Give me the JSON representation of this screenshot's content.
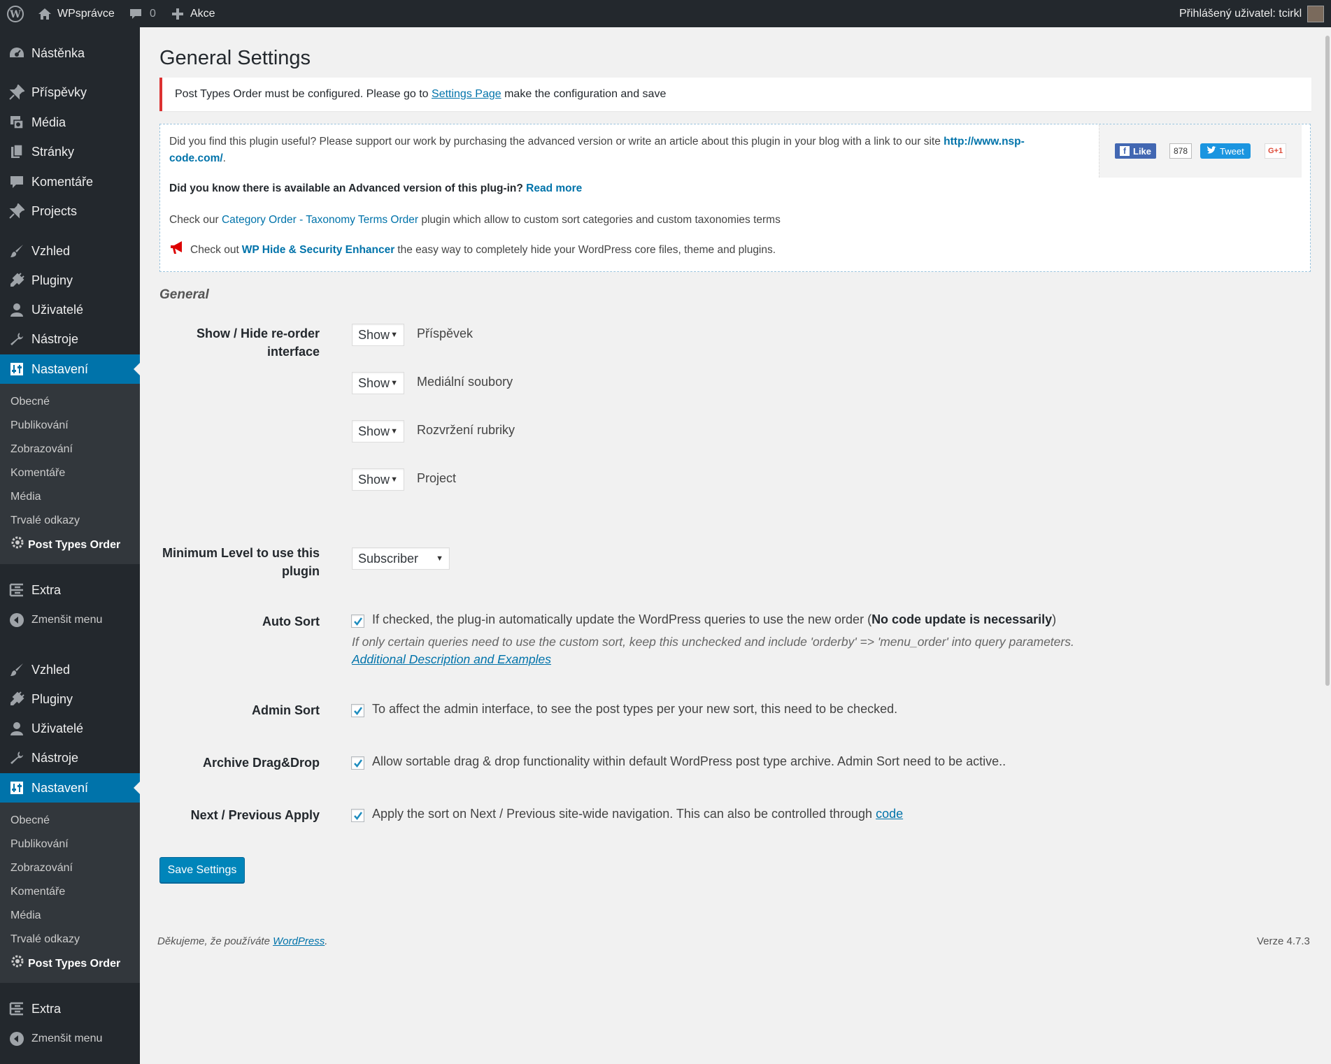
{
  "adminbar": {
    "site_name": "WPsprávce",
    "comments_count": "0",
    "new_label": "Akce",
    "user_greeting": "Přihlášený uživatel: tcirkl"
  },
  "sidebar": {
    "block1": {
      "dashboard": "Nástěnka",
      "posts": "Příspěvky",
      "media": "Média",
      "pages": "Stránky",
      "comments": "Komentáře",
      "projects": "Projects",
      "appearance": "Vzhled",
      "plugins": "Pluginy",
      "users": "Uživatelé",
      "tools": "Nástroje",
      "settings": "Nastavení",
      "sub": [
        "Obecné",
        "Publikování",
        "Zobrazování",
        "Komentáře",
        "Média",
        "Trvalé odkazy"
      ],
      "sub_active": "Post Types Order",
      "extra": "Extra",
      "collapse": "Zmenšit menu"
    },
    "block2": {
      "appearance": "Vzhled",
      "plugins": "Pluginy",
      "users": "Uživatelé",
      "tools": "Nástroje",
      "settings": "Nastavení",
      "sub": [
        "Obecné",
        "Publikování",
        "Zobrazování",
        "Komentáře",
        "Média",
        "Trvalé odkazy"
      ],
      "sub_active": "Post Types Order",
      "extra": "Extra",
      "collapse": "Zmenšit menu"
    }
  },
  "page": {
    "title": "General Settings",
    "notice": {
      "before": "Post Types Order must be configured. Please go to ",
      "link": "Settings Page",
      "after": " make the configuration and save"
    },
    "promo": {
      "p1_text": "Did you find this plugin useful? Please support our work by purchasing the advanced version or write an article about this plugin in your blog with a link to our site ",
      "p1_link_a": "http://www.nsp-",
      "p1_link_b": "code.com/",
      "p1_end": ".",
      "p2_text": "Did you know there is available an Advanced version of this plug-in? ",
      "p2_link": "Read more",
      "p3_before": "Check our ",
      "p3_link": "Category Order - Taxonomy Terms Order",
      "p3_after": " plugin which allow to custom sort categories and custom taxonomies terms",
      "p4_before": "Check out ",
      "p4_link": "WP Hide & Security Enhancer",
      "p4_after": " the easy way to completely hide your WordPress core files, theme and plugins.",
      "like_label": "Like",
      "like_count": "878",
      "tweet_label": "Tweet",
      "gplus_label": "G+1"
    },
    "section": "General",
    "show_hide": {
      "label": "Show / Hide re-order interface",
      "rows": [
        {
          "value": "Show",
          "type": "Příspěvek"
        },
        {
          "value": "Show",
          "type": "Mediální soubory"
        },
        {
          "value": "Show",
          "type": "Rozvržení rubriky"
        },
        {
          "value": "Show",
          "type": "Project"
        }
      ]
    },
    "min_level": {
      "label_line1": "Minimum Level to use this",
      "label_line2": "plugin",
      "value": "Subscriber"
    },
    "auto_sort": {
      "label": "Auto Sort",
      "text": "If checked, the plug-in automatically update the WordPress queries to use the new order (",
      "bold": "No code update is necessarily",
      "close": ")",
      "note": "If only certain queries need to use the custom sort, keep this unchecked and include 'orderby' => 'menu_order' into query parameters.",
      "link": "Additional Description and Examples"
    },
    "admin_sort": {
      "label": "Admin Sort",
      "text": "To affect the admin interface, to see the post types per your new sort, this need to be checked."
    },
    "archive_dd": {
      "label": "Archive Drag&Drop",
      "text": "Allow sortable drag & drop functionality within default WordPress post type archive. Admin Sort need to be active.."
    },
    "next_prev": {
      "label": "Next / Previous Apply",
      "text": "Apply the sort on Next / Previous site-wide navigation. This can also be controlled through ",
      "link": "code"
    },
    "save_button": "Save Settings"
  },
  "footer": {
    "thanks": "Děkujeme, že používáte ",
    "wp_link": "WordPress",
    "dot": ".",
    "version": "Verze 4.7.3"
  },
  "colors": {
    "admin_dark": "#23282d",
    "submenu_bg": "#32373c",
    "accent": "#0073aa",
    "error": "#dc3232",
    "button": "#0085ba"
  }
}
